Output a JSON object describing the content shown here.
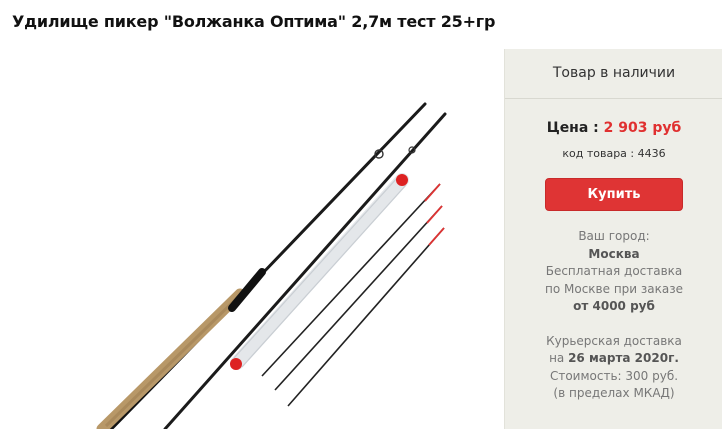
{
  "product": {
    "title": "Удилище пикер \"Волжанка Оптима\" 2,7м тест 25+гр"
  },
  "sidebar": {
    "stock_text": "Товар в наличии",
    "price_label": "Цена : ",
    "price_value": "2 903 руб",
    "code_text": "код товара : 4436",
    "buy_label": "Купить",
    "city_label": "Ваш город:",
    "city_value": "Москва",
    "free_delivery_line1": "Бесплатная доставка",
    "free_delivery_line2": "по Москве при заказе",
    "free_delivery_threshold": "от 4000 руб",
    "courier_line1": "Курьерская доставка",
    "courier_date_prefix": "на ",
    "courier_date": "26 марта 2020г.",
    "courier_cost": "Стоимость: 300 руб.",
    "courier_area": "(в пределах МКАД)"
  },
  "colors": {
    "price": "#e03030",
    "button": "#df3434",
    "sidebar_bg": "#eeeee8"
  }
}
